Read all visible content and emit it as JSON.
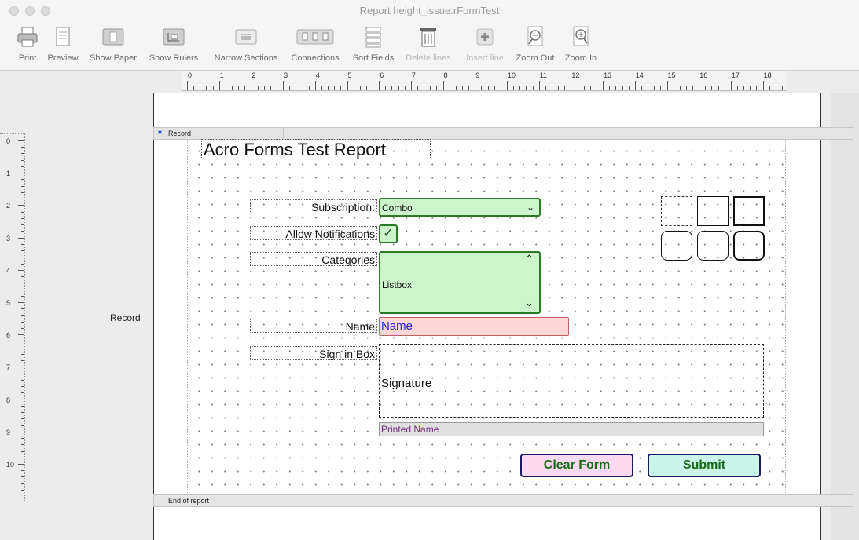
{
  "window": {
    "title": "Report height_issue.rFormTest"
  },
  "toolbar": {
    "buttons": [
      {
        "label": "Print",
        "icon": "printer-icon",
        "enabled": true
      },
      {
        "label": "Preview",
        "icon": "preview-icon",
        "enabled": true
      },
      {
        "label": "Show Paper",
        "icon": "paper-icon",
        "enabled": true
      },
      {
        "label": "Show Rulers",
        "icon": "ruler-icon",
        "enabled": true
      },
      {
        "label": "Narrow Sections",
        "icon": "narrow-sections-icon",
        "enabled": true
      },
      {
        "label": "Connections",
        "icon": "connections-icon",
        "enabled": true
      },
      {
        "label": "Sort Fields",
        "icon": "sort-fields-icon",
        "enabled": true
      },
      {
        "label": "Delete lines",
        "icon": "trash-icon",
        "enabled": false
      },
      {
        "label": "Insert line",
        "icon": "plus-icon",
        "enabled": false
      },
      {
        "label": "Zoom Out",
        "icon": "zoom-out-icon",
        "enabled": true
      },
      {
        "label": "Zoom In",
        "icon": "zoom-in-icon",
        "enabled": true
      }
    ]
  },
  "ruler": {
    "h_numbers": [
      "0",
      "1",
      "2",
      "3",
      "4",
      "5",
      "6",
      "7",
      "8",
      "9",
      "10",
      "11",
      "12",
      "13",
      "14",
      "15",
      "16",
      "17",
      "18"
    ],
    "v_numbers": [
      "0",
      "1",
      "2",
      "3",
      "4",
      "5",
      "6",
      "7",
      "8",
      "9",
      "10"
    ]
  },
  "sections": {
    "record": "Record",
    "end": "End of report",
    "side_label": "Record"
  },
  "report": {
    "title": "Acro Forms Test Report",
    "labels": {
      "subscription": "Subscription:",
      "allow": "Allow Notifications",
      "categories": "Categories",
      "name": "Name",
      "sign": "Sign in Box"
    },
    "fields": {
      "combo": "Combo",
      "checkbox": "✓",
      "listbox": "Listbox",
      "name": "Name",
      "signature": "Signature",
      "printed_name": "Printed Name"
    },
    "buttons": {
      "clear": "Clear Form",
      "submit": "Submit"
    }
  },
  "colors": {
    "green_fill": "#ccf5cc",
    "green_border": "#2a7a2a",
    "pink_fill": "#ffd6d6",
    "name_text": "#2222dd",
    "purple": "#7a2a8a"
  }
}
